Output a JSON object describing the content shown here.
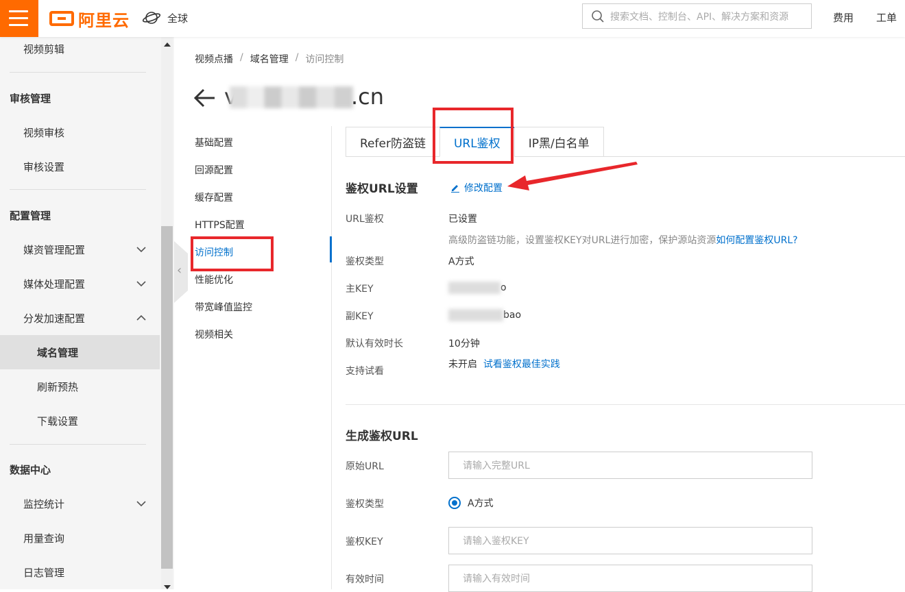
{
  "topbar": {
    "brand": "阿里云",
    "region": "全球",
    "search_placeholder": "搜索文档、控制台、API、解决方案和资源",
    "links": [
      "费用",
      "工单"
    ],
    "brand_color": "#ff6a00"
  },
  "sidebar": {
    "items": [
      {
        "label": "视频剪辑",
        "level": "lv1"
      },
      {
        "label": "审核管理",
        "level": "group"
      },
      {
        "label": "视频审核",
        "level": "lv1"
      },
      {
        "label": "审核设置",
        "level": "lv1"
      },
      {
        "label": "配置管理",
        "level": "group"
      },
      {
        "label": "媒资管理配置",
        "level": "lv1",
        "chevron": "down"
      },
      {
        "label": "媒体处理配置",
        "level": "lv1",
        "chevron": "down"
      },
      {
        "label": "分发加速配置",
        "level": "lv1",
        "chevron": "up"
      },
      {
        "label": "域名管理",
        "level": "lv2",
        "active": true
      },
      {
        "label": "刷新预热",
        "level": "lv2"
      },
      {
        "label": "下载设置",
        "level": "lv2"
      },
      {
        "label": "数据中心",
        "level": "group"
      },
      {
        "label": "监控统计",
        "level": "lv1",
        "chevron": "down"
      },
      {
        "label": "用量查询",
        "level": "lv1"
      },
      {
        "label": "日志管理",
        "level": "lv1"
      }
    ]
  },
  "breadcrumb": [
    "视频点播",
    "域名管理",
    "访问控制"
  ],
  "domain": {
    "suffix": ".cn",
    "prefix": "v"
  },
  "subnav": [
    "基础配置",
    "回源配置",
    "缓存配置",
    "HTTPS配置",
    "访问控制",
    "性能优化",
    "带宽峰值监控",
    "视频相关"
  ],
  "subnav_active": "访问控制",
  "tabs": [
    "Refer防盗链",
    "URL鉴权",
    "IP黑/白名单"
  ],
  "tab_active": "URL鉴权",
  "auth_section": {
    "title": "鉴权URL设置",
    "edit_label": "修改配置",
    "rows": [
      {
        "label": "URL鉴权",
        "value": "已设置"
      },
      {
        "label": "鉴权类型",
        "value": "A方式"
      },
      {
        "label": "主KEY",
        "value": "o"
      },
      {
        "label": "副KEY",
        "value": "bao"
      },
      {
        "label": "默认有效时长",
        "value": "10分钟"
      },
      {
        "label": "支持试看",
        "value": "未开启"
      }
    ],
    "desc": "高级防盗链功能，设置鉴权KEY对URL进行加密，保护源站资源",
    "desc_link": "如何配置鉴权URL?",
    "trial_link": "试看鉴权最佳实践"
  },
  "generate_section": {
    "title": "生成鉴权URL",
    "labels": {
      "url": "原始URL",
      "type": "鉴权类型",
      "key": "鉴权KEY",
      "time": "有效时间"
    },
    "url_placeholder": "请输入完整URL",
    "type_option": "A方式",
    "key_placeholder": "请输入鉴权KEY",
    "time_placeholder": "请输入有效时间"
  },
  "colors": {
    "accent": "#0070cc",
    "annotation": "#e8272b"
  }
}
